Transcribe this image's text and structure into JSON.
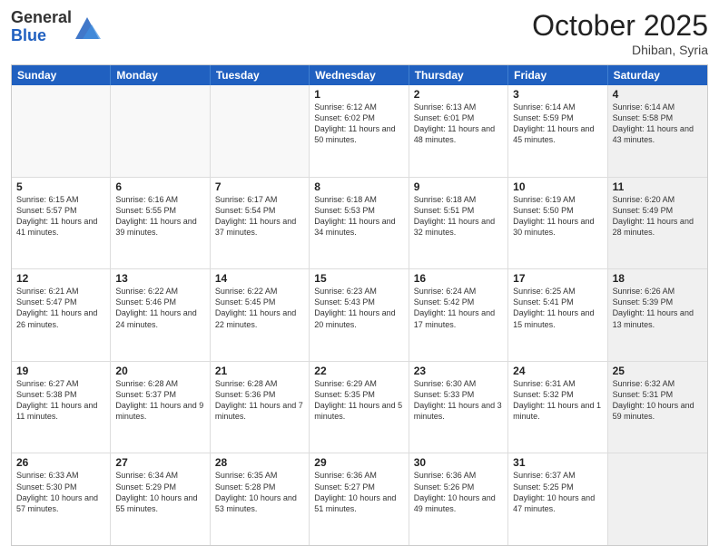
{
  "logo": {
    "general": "General",
    "blue": "Blue"
  },
  "title": "October 2025",
  "subtitle": "Dhiban, Syria",
  "days": [
    "Sunday",
    "Monday",
    "Tuesday",
    "Wednesday",
    "Thursday",
    "Friday",
    "Saturday"
  ],
  "rows": [
    [
      {
        "day": "",
        "text": "",
        "empty": true
      },
      {
        "day": "",
        "text": "",
        "empty": true
      },
      {
        "day": "",
        "text": "",
        "empty": true
      },
      {
        "day": "1",
        "text": "Sunrise: 6:12 AM\nSunset: 6:02 PM\nDaylight: 11 hours\nand 50 minutes.",
        "empty": false
      },
      {
        "day": "2",
        "text": "Sunrise: 6:13 AM\nSunset: 6:01 PM\nDaylight: 11 hours\nand 48 minutes.",
        "empty": false
      },
      {
        "day": "3",
        "text": "Sunrise: 6:14 AM\nSunset: 5:59 PM\nDaylight: 11 hours\nand 45 minutes.",
        "empty": false
      },
      {
        "day": "4",
        "text": "Sunrise: 6:14 AM\nSunset: 5:58 PM\nDaylight: 11 hours\nand 43 minutes.",
        "empty": false,
        "shaded": true
      }
    ],
    [
      {
        "day": "5",
        "text": "Sunrise: 6:15 AM\nSunset: 5:57 PM\nDaylight: 11 hours\nand 41 minutes.",
        "empty": false
      },
      {
        "day": "6",
        "text": "Sunrise: 6:16 AM\nSunset: 5:55 PM\nDaylight: 11 hours\nand 39 minutes.",
        "empty": false
      },
      {
        "day": "7",
        "text": "Sunrise: 6:17 AM\nSunset: 5:54 PM\nDaylight: 11 hours\nand 37 minutes.",
        "empty": false
      },
      {
        "day": "8",
        "text": "Sunrise: 6:18 AM\nSunset: 5:53 PM\nDaylight: 11 hours\nand 34 minutes.",
        "empty": false
      },
      {
        "day": "9",
        "text": "Sunrise: 6:18 AM\nSunset: 5:51 PM\nDaylight: 11 hours\nand 32 minutes.",
        "empty": false
      },
      {
        "day": "10",
        "text": "Sunrise: 6:19 AM\nSunset: 5:50 PM\nDaylight: 11 hours\nand 30 minutes.",
        "empty": false
      },
      {
        "day": "11",
        "text": "Sunrise: 6:20 AM\nSunset: 5:49 PM\nDaylight: 11 hours\nand 28 minutes.",
        "empty": false,
        "shaded": true
      }
    ],
    [
      {
        "day": "12",
        "text": "Sunrise: 6:21 AM\nSunset: 5:47 PM\nDaylight: 11 hours\nand 26 minutes.",
        "empty": false
      },
      {
        "day": "13",
        "text": "Sunrise: 6:22 AM\nSunset: 5:46 PM\nDaylight: 11 hours\nand 24 minutes.",
        "empty": false
      },
      {
        "day": "14",
        "text": "Sunrise: 6:22 AM\nSunset: 5:45 PM\nDaylight: 11 hours\nand 22 minutes.",
        "empty": false
      },
      {
        "day": "15",
        "text": "Sunrise: 6:23 AM\nSunset: 5:43 PM\nDaylight: 11 hours\nand 20 minutes.",
        "empty": false
      },
      {
        "day": "16",
        "text": "Sunrise: 6:24 AM\nSunset: 5:42 PM\nDaylight: 11 hours\nand 17 minutes.",
        "empty": false
      },
      {
        "day": "17",
        "text": "Sunrise: 6:25 AM\nSunset: 5:41 PM\nDaylight: 11 hours\nand 15 minutes.",
        "empty": false
      },
      {
        "day": "18",
        "text": "Sunrise: 6:26 AM\nSunset: 5:39 PM\nDaylight: 11 hours\nand 13 minutes.",
        "empty": false,
        "shaded": true
      }
    ],
    [
      {
        "day": "19",
        "text": "Sunrise: 6:27 AM\nSunset: 5:38 PM\nDaylight: 11 hours\nand 11 minutes.",
        "empty": false
      },
      {
        "day": "20",
        "text": "Sunrise: 6:28 AM\nSunset: 5:37 PM\nDaylight: 11 hours\nand 9 minutes.",
        "empty": false
      },
      {
        "day": "21",
        "text": "Sunrise: 6:28 AM\nSunset: 5:36 PM\nDaylight: 11 hours\nand 7 minutes.",
        "empty": false
      },
      {
        "day": "22",
        "text": "Sunrise: 6:29 AM\nSunset: 5:35 PM\nDaylight: 11 hours\nand 5 minutes.",
        "empty": false
      },
      {
        "day": "23",
        "text": "Sunrise: 6:30 AM\nSunset: 5:33 PM\nDaylight: 11 hours\nand 3 minutes.",
        "empty": false
      },
      {
        "day": "24",
        "text": "Sunrise: 6:31 AM\nSunset: 5:32 PM\nDaylight: 11 hours\nand 1 minute.",
        "empty": false
      },
      {
        "day": "25",
        "text": "Sunrise: 6:32 AM\nSunset: 5:31 PM\nDaylight: 10 hours\nand 59 minutes.",
        "empty": false,
        "shaded": true
      }
    ],
    [
      {
        "day": "26",
        "text": "Sunrise: 6:33 AM\nSunset: 5:30 PM\nDaylight: 10 hours\nand 57 minutes.",
        "empty": false
      },
      {
        "day": "27",
        "text": "Sunrise: 6:34 AM\nSunset: 5:29 PM\nDaylight: 10 hours\nand 55 minutes.",
        "empty": false
      },
      {
        "day": "28",
        "text": "Sunrise: 6:35 AM\nSunset: 5:28 PM\nDaylight: 10 hours\nand 53 minutes.",
        "empty": false
      },
      {
        "day": "29",
        "text": "Sunrise: 6:36 AM\nSunset: 5:27 PM\nDaylight: 10 hours\nand 51 minutes.",
        "empty": false
      },
      {
        "day": "30",
        "text": "Sunrise: 6:36 AM\nSunset: 5:26 PM\nDaylight: 10 hours\nand 49 minutes.",
        "empty": false
      },
      {
        "day": "31",
        "text": "Sunrise: 6:37 AM\nSunset: 5:25 PM\nDaylight: 10 hours\nand 47 minutes.",
        "empty": false
      },
      {
        "day": "",
        "text": "",
        "empty": true,
        "shaded": true
      }
    ]
  ]
}
